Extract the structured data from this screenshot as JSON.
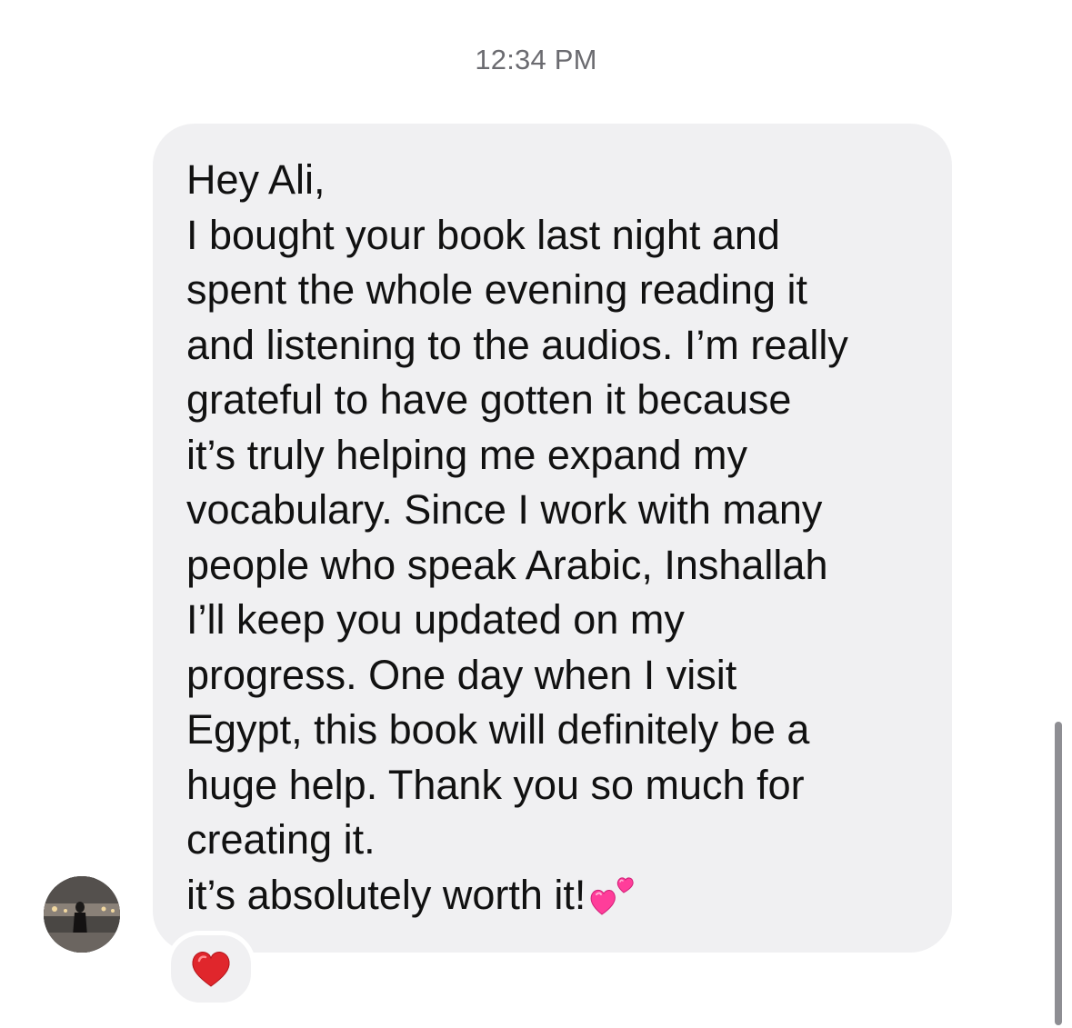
{
  "thread": {
    "timestamp": "12:34 PM"
  },
  "message": {
    "lines": [
      "Hey Ali,",
      "I bought your book last night and",
      "spent the whole evening reading it",
      "and listening to the audios. I’m really",
      "grateful to have gotten it because",
      "it’s truly helping me expand my",
      "vocabulary. Since I work with many",
      "people who speak Arabic, Inshallah",
      "I’ll keep you updated on my",
      "progress. One day when I visit",
      "Egypt, this book will definitely be a",
      "huge help. Thank you so much for",
      "creating it.",
      "it’s absolutely worth it!"
    ],
    "trailing_emoji": "two-hearts-icon",
    "reaction": "red-heart-icon"
  },
  "colors": {
    "bubble": "#f0f0f2",
    "text": "#111111",
    "timestamp": "#6b6b70",
    "heart_red": "#e0262c",
    "heart_pink": "#ff2f92"
  }
}
